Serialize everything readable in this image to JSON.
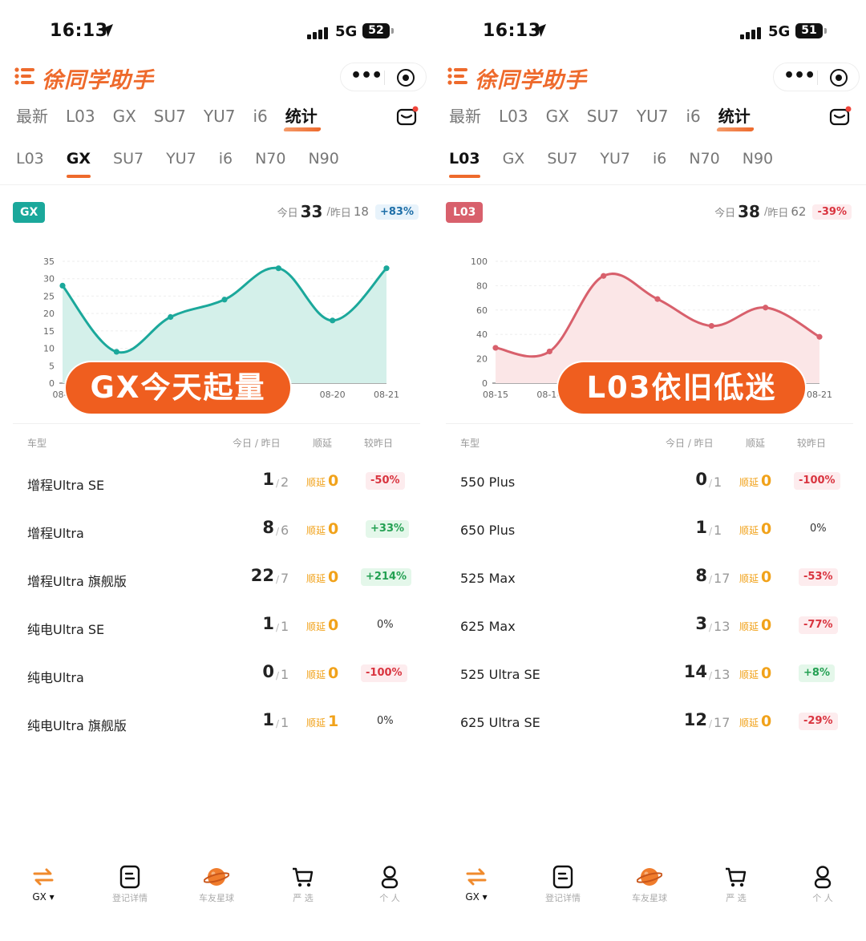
{
  "screens": [
    {
      "status": {
        "time": "16:13",
        "network": "5G",
        "battery": "52"
      },
      "app_title": "徐同学助手",
      "main_tabs": [
        "最新",
        "L03",
        "GX",
        "SU7",
        "YU7",
        "i6",
        "统计"
      ],
      "main_active": 6,
      "sub_tabs": [
        "L03",
        "GX",
        "SU7",
        "YU7",
        "i6",
        "N70",
        "N90"
      ],
      "sub_active": 1,
      "badge": {
        "label": "GX",
        "color": "#1ba89b"
      },
      "summary": {
        "today_label": "今日",
        "today": "33",
        "yesterday_label": "昨日",
        "yesterday": "18",
        "change": "+83%",
        "change_tone": "blue"
      },
      "overlay": "GX今天起量",
      "chart_data": {
        "type": "area",
        "x": [
          "08-15",
          "08-16",
          "08-17",
          "08-18",
          "08-19",
          "08-20",
          "08-21"
        ],
        "x_tick_labels": [
          "08-1",
          "08-20",
          "08-21"
        ],
        "values": [
          28,
          9,
          19,
          24,
          33,
          18,
          33
        ],
        "y_ticks": [
          0,
          5,
          10,
          15,
          20,
          25,
          30,
          35
        ],
        "ylim": [
          0,
          35
        ],
        "line_color": "#1ba89b",
        "fill_color": "#d4f0ea"
      },
      "table": {
        "headers": {
          "model": "车型",
          "today_yest": "今日 / 昨日",
          "delay": "顺延",
          "vs_yest": "较昨日"
        },
        "delay_label": "顺延",
        "rows": [
          {
            "name": "增程Ultra SE",
            "today": "1",
            "yest": "2",
            "delay": "0",
            "pct": "-50%",
            "tone": "red"
          },
          {
            "name": "增程Ultra",
            "today": "8",
            "yest": "6",
            "delay": "0",
            "pct": "+33%",
            "tone": "green"
          },
          {
            "name": "增程Ultra 旗舰版",
            "today": "22",
            "yest": "7",
            "delay": "0",
            "pct": "+214%",
            "tone": "green"
          },
          {
            "name": "纯电Ultra SE",
            "today": "1",
            "yest": "1",
            "delay": "0",
            "pct": "0%",
            "tone": "plain"
          },
          {
            "name": "纯电Ultra",
            "today": "0",
            "yest": "1",
            "delay": "0",
            "pct": "-100%",
            "tone": "red"
          },
          {
            "name": "纯电Ultra 旗舰版",
            "today": "1",
            "yest": "1",
            "delay": "1",
            "pct": "0%",
            "tone": "plain"
          }
        ]
      },
      "nav": [
        "GX ▾",
        "登记详情",
        "车友星球",
        "严 选",
        "个 人"
      ]
    },
    {
      "status": {
        "time": "16:13",
        "network": "5G",
        "battery": "51"
      },
      "app_title": "徐同学助手",
      "main_tabs": [
        "最新",
        "L03",
        "GX",
        "SU7",
        "YU7",
        "i6",
        "统计"
      ],
      "main_active": 6,
      "sub_tabs": [
        "L03",
        "GX",
        "SU7",
        "YU7",
        "i6",
        "N70",
        "N90"
      ],
      "sub_active": 0,
      "badge": {
        "label": "L03",
        "color": "#d8606c"
      },
      "summary": {
        "today_label": "今日",
        "today": "38",
        "yesterday_label": "昨日",
        "yesterday": "62",
        "change": "-39%",
        "change_tone": "red"
      },
      "overlay": "L03依旧低迷",
      "chart_data": {
        "type": "area",
        "x": [
          "08-15",
          "08-16",
          "08-17",
          "08-18",
          "08-19",
          "08-20",
          "08-21"
        ],
        "x_tick_labels": [
          "08-15",
          "08-16",
          "08-21"
        ],
        "values": [
          29,
          26,
          88,
          69,
          47,
          62,
          38
        ],
        "y_ticks": [
          0,
          20,
          40,
          60,
          80,
          100
        ],
        "ylim": [
          0,
          100
        ],
        "line_color": "#d8606c",
        "fill_color": "#fbe6e7"
      },
      "table": {
        "headers": {
          "model": "车型",
          "today_yest": "今日 / 昨日",
          "delay": "顺延",
          "vs_yest": "较昨日"
        },
        "delay_label": "顺延",
        "rows": [
          {
            "name": "550 Plus",
            "today": "0",
            "yest": "1",
            "delay": "0",
            "pct": "-100%",
            "tone": "red"
          },
          {
            "name": "650 Plus",
            "today": "1",
            "yest": "1",
            "delay": "0",
            "pct": "0%",
            "tone": "plain"
          },
          {
            "name": "525 Max",
            "today": "8",
            "yest": "17",
            "delay": "0",
            "pct": "-53%",
            "tone": "red"
          },
          {
            "name": "625 Max",
            "today": "3",
            "yest": "13",
            "delay": "0",
            "pct": "-77%",
            "tone": "red"
          },
          {
            "name": "525 Ultra SE",
            "today": "14",
            "yest": "13",
            "delay": "0",
            "pct": "+8%",
            "tone": "green"
          },
          {
            "name": "625 Ultra SE",
            "today": "12",
            "yest": "17",
            "delay": "0",
            "pct": "-29%",
            "tone": "red"
          }
        ]
      },
      "nav": [
        "GX ▾",
        "登记详情",
        "车友星球",
        "严 选",
        "个 人"
      ]
    }
  ]
}
